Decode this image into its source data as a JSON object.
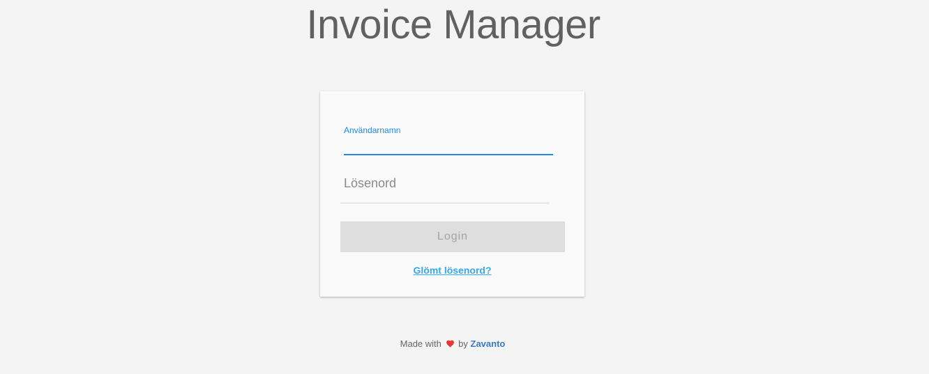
{
  "app": {
    "title": "Invoice Manager"
  },
  "login_form": {
    "username_label": "Användarnamn",
    "username_value": "",
    "password_placeholder": "Lösenord",
    "password_value": "",
    "login_label": "Login",
    "forgot_password_label": "Glömt lösenord?"
  },
  "footer": {
    "made_with": "Made with",
    "by": "by",
    "brand": "Zavanto",
    "heart_icon": "heart-icon"
  },
  "colors": {
    "accent": "#1e88e5",
    "link": "#35a8f0",
    "brand_link": "#3b78c8",
    "heart": "#e53935",
    "button_disabled_bg": "#dedede",
    "page_bg": "#f4f4f4"
  }
}
